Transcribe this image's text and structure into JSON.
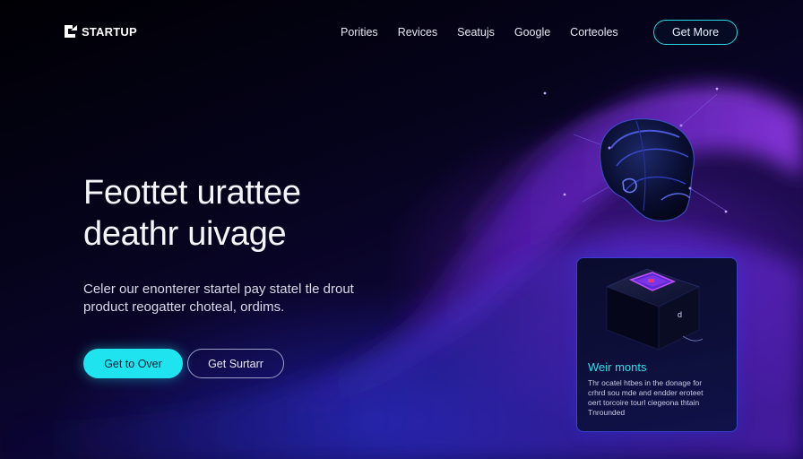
{
  "brand": {
    "name": "STARTUP"
  },
  "nav": {
    "links": [
      "Porities",
      "Revices",
      "Seatujs",
      "Google",
      "Corteoles"
    ],
    "cta_label": "Get More"
  },
  "hero": {
    "title_line1": "Feottet urattee",
    "title_line2": "deathr uivage",
    "subtitle_line1": "Celer our enonterer startel pay statel tle drout",
    "subtitle_line2": "product reogatter choteal, ordims.",
    "primary_button": "Get to Over",
    "secondary_button": "Get Surtarr"
  },
  "card": {
    "title": "Weir monts",
    "body_line1": "Thr ocatel htbes in the donage for",
    "body_line2": "crhrd sou mde and endder eroteet",
    "body_line3": "oert torcoire tourl ciegeona thtain",
    "body_line4": "Tnrounded"
  },
  "colors": {
    "accent_cyan": "#20e3f0",
    "accent_purple": "#8a2be2",
    "background_dark": "#05031a"
  },
  "icons": {
    "logo": "startup-logo-icon",
    "hero_art": "helmet-icon",
    "card_art": "device-box-icon"
  }
}
